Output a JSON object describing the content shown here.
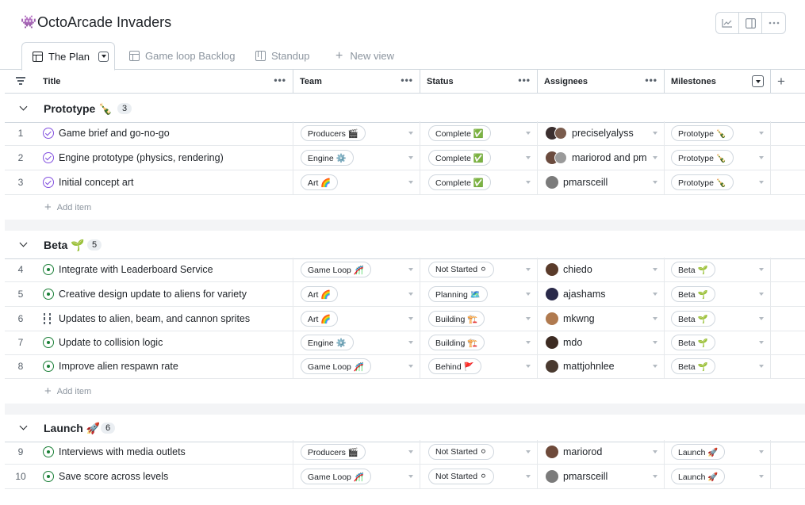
{
  "project": {
    "icon": "👾",
    "title": "OctoArcade Invaders"
  },
  "top_actions": [
    "insights-icon",
    "side-panel-icon",
    "more-icon"
  ],
  "views": [
    {
      "label": "The Plan",
      "icon": "table-icon",
      "active": true
    },
    {
      "label": "Game loop Backlog",
      "icon": "table-icon",
      "active": false
    },
    {
      "label": "Standup",
      "icon": "board-icon",
      "active": false
    },
    {
      "label": "New view",
      "icon": "plus-icon",
      "active": false
    }
  ],
  "columns": {
    "title": "Title",
    "team": "Team",
    "status": "Status",
    "assignees": "Assignees",
    "milestones": "Milestones"
  },
  "add_item_label": "Add item",
  "groups": [
    {
      "name": "Prototype 🍾",
      "count": "3"
    },
    {
      "name": "Beta 🌱",
      "count": "5"
    },
    {
      "name": "Launch 🚀",
      "count": "6"
    }
  ],
  "rows": [
    {
      "num": "1",
      "state": "done",
      "title": "Game brief and go-no-go",
      "team": "Producers 🎬",
      "status": "Complete ✅",
      "assignee": "preciselyalyss",
      "milestone": "Prototype 🍾"
    },
    {
      "num": "2",
      "state": "done",
      "title": "Engine prototype (physics, rendering)",
      "team": "Engine ⚙️",
      "status": "Complete ✅",
      "assignee": "mariorod and pm",
      "milestone": "Prototype 🍾"
    },
    {
      "num": "3",
      "state": "done",
      "title": "Initial concept art",
      "team": "Art 🌈",
      "status": "Complete ✅",
      "assignee": "pmarsceill",
      "milestone": "Prototype 🍾"
    },
    {
      "num": "4",
      "state": "open",
      "title": "Integrate with Leaderboard Service",
      "team": "Game Loop 🎢",
      "status": "Not Started ⚪",
      "assignee": "chiedo",
      "milestone": "Beta 🌱"
    },
    {
      "num": "5",
      "state": "open",
      "title": "Creative design update to aliens for variety",
      "team": "Art 🌈",
      "status": "Planning 🗺️",
      "assignee": "ajashams",
      "milestone": "Beta 🌱"
    },
    {
      "num": "6",
      "state": "pr",
      "title": "Updates to alien, beam, and cannon sprites",
      "team": "Art 🌈",
      "status": "Building 🏗️",
      "assignee": "mkwng",
      "milestone": "Beta 🌱"
    },
    {
      "num": "7",
      "state": "open",
      "title": "Update to collision logic",
      "team": "Engine ⚙️",
      "status": "Building 🏗️",
      "assignee": "mdo",
      "milestone": "Beta 🌱"
    },
    {
      "num": "8",
      "state": "open",
      "title": "Improve alien respawn rate",
      "team": "Game Loop 🎢",
      "status": "Behind 🚩",
      "assignee": "mattjohnlee",
      "milestone": "Beta 🌱"
    },
    {
      "num": "9",
      "state": "open",
      "title": "Interviews with media outlets",
      "team": "Producers 🎬",
      "status": "Not Started ⚪",
      "assignee": "mariorod",
      "milestone": "Launch 🚀"
    },
    {
      "num": "10",
      "state": "open",
      "title": "Save score across levels",
      "team": "Game Loop 🎢",
      "status": "Not Started ⚪",
      "assignee": "pmarsceill",
      "milestone": "Launch 🚀"
    }
  ],
  "colors": {
    "done": "#8250df",
    "open": "#1a7f37",
    "border": "#d0d7de",
    "muted": "#8c959f",
    "group_gap": "#f3f4f6"
  }
}
